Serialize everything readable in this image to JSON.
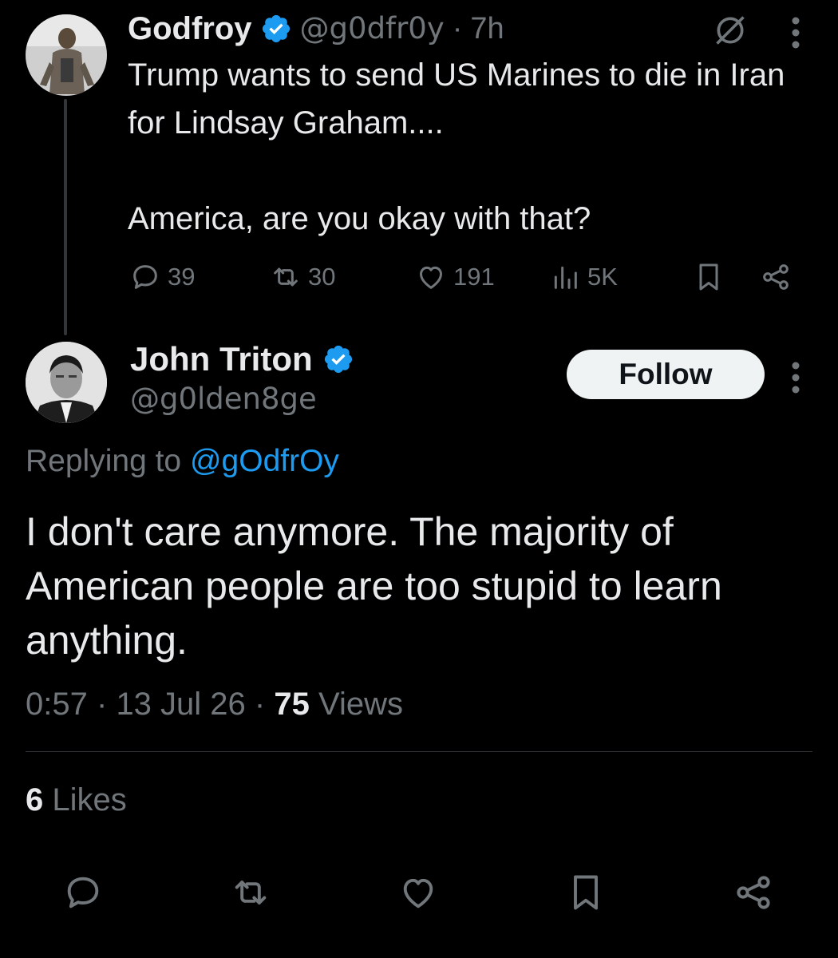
{
  "parent_tweet": {
    "name": "Godfroy",
    "handle": "@g0dfr0y",
    "separator": "·",
    "time": "7h",
    "text": "Trump wants to send US Marines to die in Iran for Lindsay Graham....\n\nAmerica, are you okay with that?",
    "stats": {
      "replies": "39",
      "reposts": "30",
      "likes": "191",
      "views": "5K"
    }
  },
  "main_tweet": {
    "name": "John Triton",
    "handle": "@g0lden8ge",
    "follow_label": "Follow",
    "replying_prefix": "Replying to",
    "replying_handle": "@gOdfrOy",
    "text": "I don't care anymore. The majority of American people are too stupid to learn anything.",
    "time": "0:57",
    "date": "13 Jul 26",
    "separator": "·",
    "views_count": "75",
    "views_label": "Views",
    "likes_count": "6",
    "likes_label": "Likes"
  },
  "colors": {
    "background": "#000000",
    "text": "#e7e9ea",
    "muted": "#71767b",
    "link": "#1d9bf0",
    "verified": "#1d9bf0"
  },
  "icons": [
    "reply-icon",
    "repost-icon",
    "like-icon",
    "views-icon",
    "bookmark-icon",
    "share-icon",
    "grok-icon",
    "more-icon",
    "verified-badge-icon"
  ]
}
